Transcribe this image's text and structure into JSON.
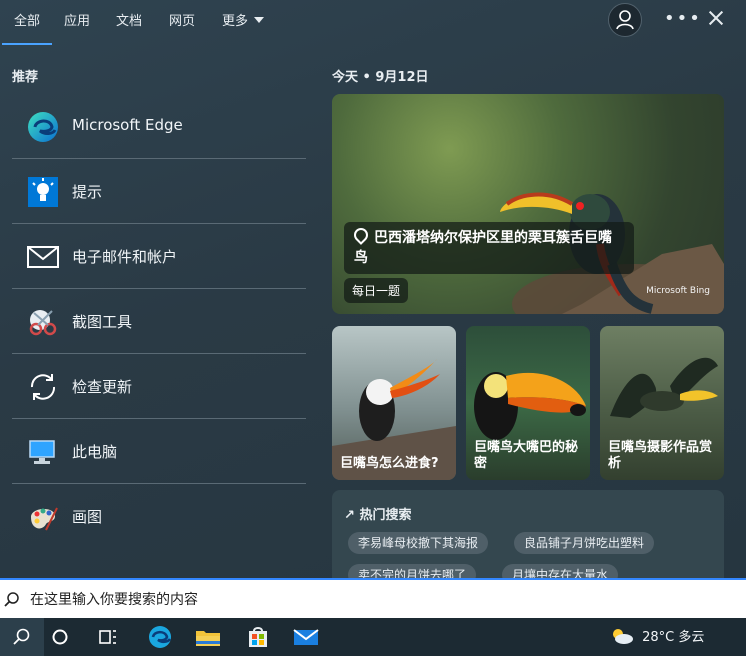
{
  "tabs": [
    {
      "label": "全部"
    },
    {
      "label": "应用"
    },
    {
      "label": "文档"
    },
    {
      "label": "网页"
    },
    {
      "label": "更多"
    }
  ],
  "left": {
    "title": "推荐",
    "items": [
      {
        "label": "Microsoft Edge",
        "icon": "edge-icon"
      },
      {
        "label": "提示",
        "icon": "tips-icon"
      },
      {
        "label": "电子邮件和帐户",
        "icon": "mail-icon"
      },
      {
        "label": "截图工具",
        "icon": "snipping-tool-icon"
      },
      {
        "label": "检查更新",
        "icon": "update-icon"
      },
      {
        "label": "此电脑",
        "icon": "pc-icon"
      },
      {
        "label": "画图",
        "icon": "paint-icon"
      }
    ]
  },
  "right": {
    "date": "今天 • 9月12日",
    "hero": {
      "title": "巴西潘塔纳尔保护区里的栗耳簇舌巨嘴鸟",
      "chip": "每日一题",
      "watermark": "Microsoft Bing"
    },
    "minis": [
      {
        "caption": "巨嘴鸟怎么进食?"
      },
      {
        "caption": "巨嘴鸟大嘴巴的秘密"
      },
      {
        "caption": "巨嘴鸟摄影作品赏析"
      }
    ],
    "trending": {
      "title": "热门搜索",
      "pills": [
        "李易峰母校撤下其海报",
        "良品铺子月饼吃出塑料",
        "卖不完的月饼去哪了",
        "月壤中存在大量水"
      ]
    }
  },
  "search": {
    "placeholder": "在这里输入你要搜索的内容"
  },
  "weather": {
    "text": "28°C 多云"
  }
}
